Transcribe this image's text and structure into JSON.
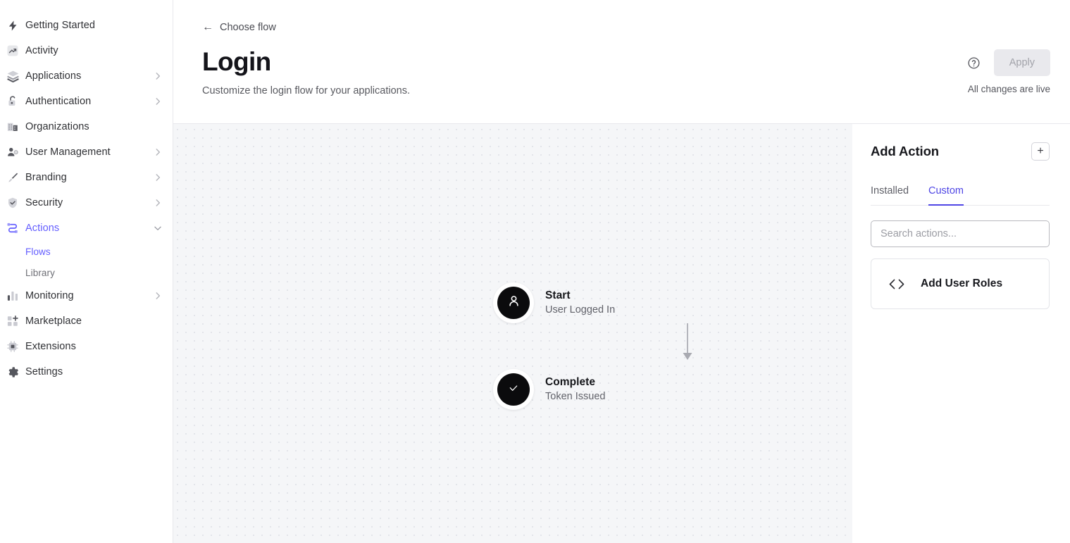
{
  "sidebar": {
    "items": [
      {
        "label": "Getting Started",
        "icon": "bolt-icon",
        "chevron": false,
        "active": false
      },
      {
        "label": "Activity",
        "icon": "trend-up-icon",
        "chevron": false,
        "active": false
      },
      {
        "label": "Applications",
        "icon": "stack-icon",
        "chevron": true,
        "active": false
      },
      {
        "label": "Authentication",
        "icon": "lock-open-icon",
        "chevron": true,
        "active": false
      },
      {
        "label": "Organizations",
        "icon": "building-icon",
        "chevron": false,
        "active": false
      },
      {
        "label": "User Management",
        "icon": "user-gear-icon",
        "chevron": true,
        "active": false
      },
      {
        "label": "Branding",
        "icon": "paintbrush-icon",
        "chevron": true,
        "active": false
      },
      {
        "label": "Security",
        "icon": "shield-check-icon",
        "chevron": true,
        "active": false
      },
      {
        "label": "Actions",
        "icon": "actions-flow-icon",
        "chevron": true,
        "expanded": true,
        "active": true
      },
      {
        "label": "Monitoring",
        "icon": "bar-chart-icon",
        "chevron": true,
        "active": false
      },
      {
        "label": "Marketplace",
        "icon": "marketplace-plus-icon",
        "chevron": false,
        "active": false
      },
      {
        "label": "Extensions",
        "icon": "chip-icon",
        "chevron": false,
        "active": false
      },
      {
        "label": "Settings",
        "icon": "gear-icon",
        "chevron": false,
        "active": false
      }
    ],
    "sub_items": [
      {
        "label": "Flows",
        "active": true
      },
      {
        "label": "Library",
        "active": false
      }
    ],
    "accent_color": "#635dff"
  },
  "header": {
    "back_label": "Choose flow",
    "title": "Login",
    "subtitle": "Customize the login flow for your applications.",
    "apply_label": "Apply",
    "changes_note": "All changes are live",
    "help_icon": "question-circle-icon"
  },
  "canvas": {
    "nodes": [
      {
        "title": "Start",
        "subtitle": "User Logged In",
        "icon": "person-icon"
      },
      {
        "title": "Complete",
        "subtitle": "Token Issued",
        "icon": "check-icon"
      }
    ]
  },
  "panel": {
    "title": "Add Action",
    "add_button_label": "+",
    "tabs": [
      {
        "label": "Installed",
        "active": false
      },
      {
        "label": "Custom",
        "active": true
      }
    ],
    "search": {
      "value": "",
      "placeholder": "Search actions..."
    },
    "actions": [
      {
        "label": "Add User Roles",
        "icon": "code-brackets-icon"
      }
    ],
    "accent_color": "#4f46e5"
  }
}
